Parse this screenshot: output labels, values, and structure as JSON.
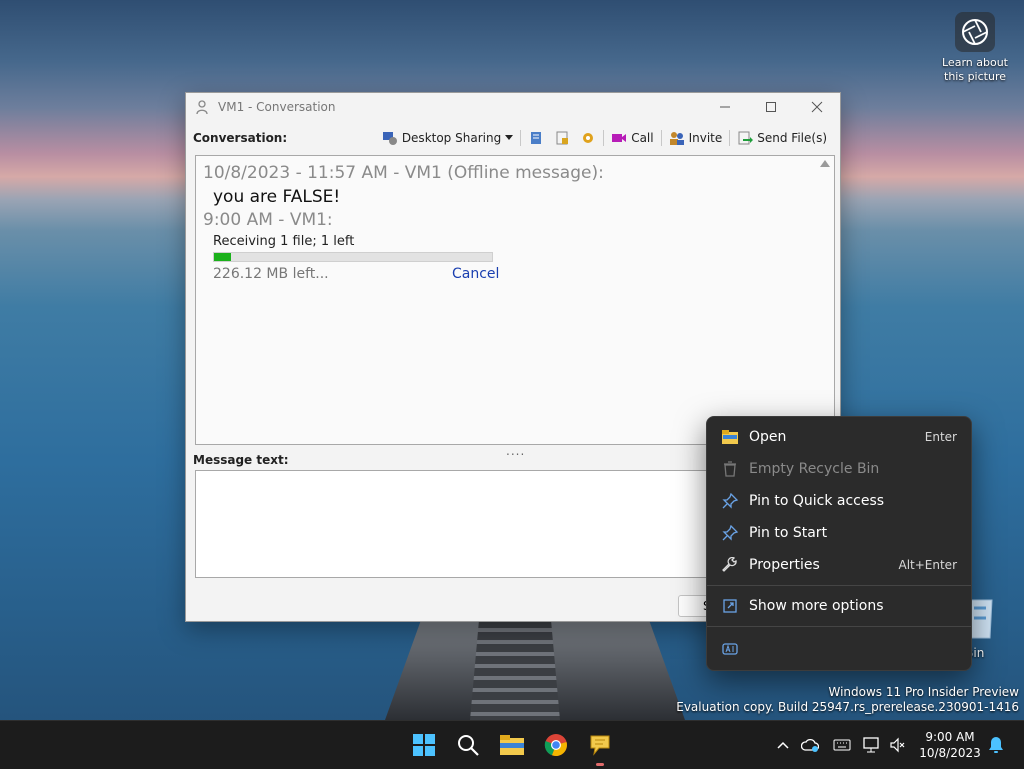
{
  "desktop": {
    "learn_about_line1": "Learn about",
    "learn_about_line2": "this picture",
    "recycle_bin_label": "cle Bin",
    "watermark_line1": "Windows 11 Pro Insider Preview",
    "watermark_line2": "Evaluation copy. Build 25947.rs_prerelease.230901-1416"
  },
  "window": {
    "title": "VM1 - Conversation",
    "conversation_label": "Conversation:",
    "toolbar": {
      "desktop_sharing": "Desktop Sharing",
      "call": "Call",
      "invite": "Invite",
      "send_files": "Send File(s)"
    },
    "messages": {
      "header1": "10/8/2023 - 11:57 AM - VM1 (Offline message):",
      "body1": "you are FALSE!",
      "header2": "9:00 AM - VM1:",
      "receiving": "Receiving 1 file; 1 left",
      "progress_fraction": 0.06,
      "left_text": "226.12 MB left...",
      "cancel": "Cancel"
    },
    "splitter": "....",
    "message_label": "Message text:",
    "message_value": "",
    "send_button": "S"
  },
  "context_menu": {
    "items": [
      {
        "label": "Open",
        "shortcut": "Enter",
        "icon": "folder-icon",
        "disabled": false
      },
      {
        "label": "Empty Recycle Bin",
        "shortcut": "",
        "icon": "trash-icon",
        "disabled": true
      },
      {
        "label": "Pin to Quick access",
        "shortcut": "",
        "icon": "pin-icon",
        "disabled": false
      },
      {
        "label": "Pin to Start",
        "shortcut": "",
        "icon": "pin-icon",
        "disabled": false
      },
      {
        "label": "Properties",
        "shortcut": "Alt+Enter",
        "icon": "wrench-icon",
        "disabled": false
      },
      {
        "label": "Show more options",
        "shortcut": "",
        "icon": "share-icon",
        "disabled": false
      }
    ]
  },
  "taskbar": {
    "time": "9:00 AM",
    "date": "10/8/2023"
  },
  "colors": {
    "accent_blue": "#1a3fb0",
    "progress_green": "#1bb11b",
    "taskbar": "#1c1c1c",
    "menu_bg": "#2b2b2b"
  }
}
